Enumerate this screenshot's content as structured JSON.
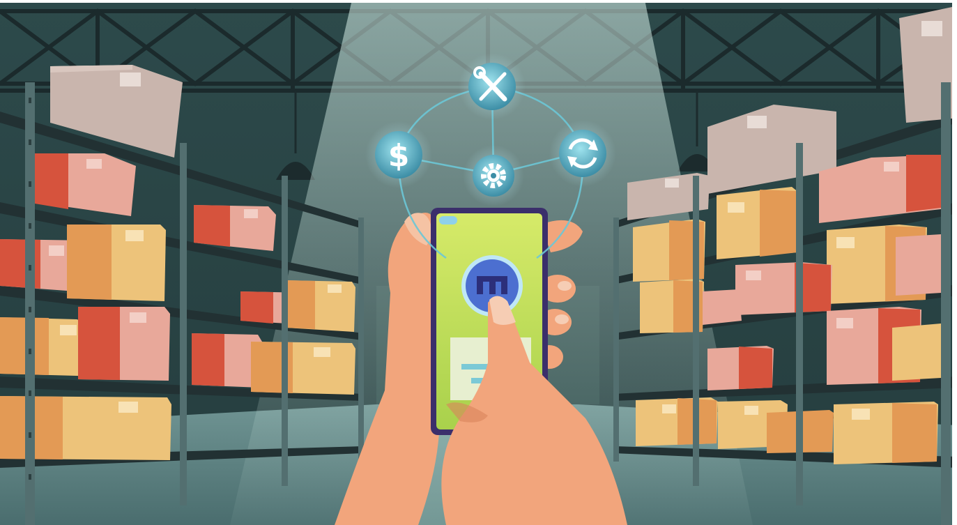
{
  "scene": {
    "colors": {
      "wall": "#2c4748",
      "wall_dark": "#1f3536",
      "truss": "#1c2b2d",
      "floor": "#5b7f80",
      "floor_light": "#8fb0ad",
      "shelf": "#243234",
      "post": "#4f6c6d",
      "light_beam": "#cfe9e2",
      "box_red": "#d6533d",
      "box_pink": "#e8a89a",
      "box_orange": "#e39a55",
      "box_yellow": "#edc37a",
      "box_grey": "#c9b5ad",
      "skin": "#f2a57c",
      "skin_shade": "#d9845c",
      "phone_body": "#3b2f6b",
      "phone_screen": "#c7e25a",
      "phone_icon": "#4c6fd0",
      "network_icon": "#6cc7d6"
    },
    "icons": [
      "wrench-screwdriver-icon",
      "dollar-icon",
      "gear-icon",
      "refresh-icon",
      "hierarchy-icon"
    ]
  }
}
